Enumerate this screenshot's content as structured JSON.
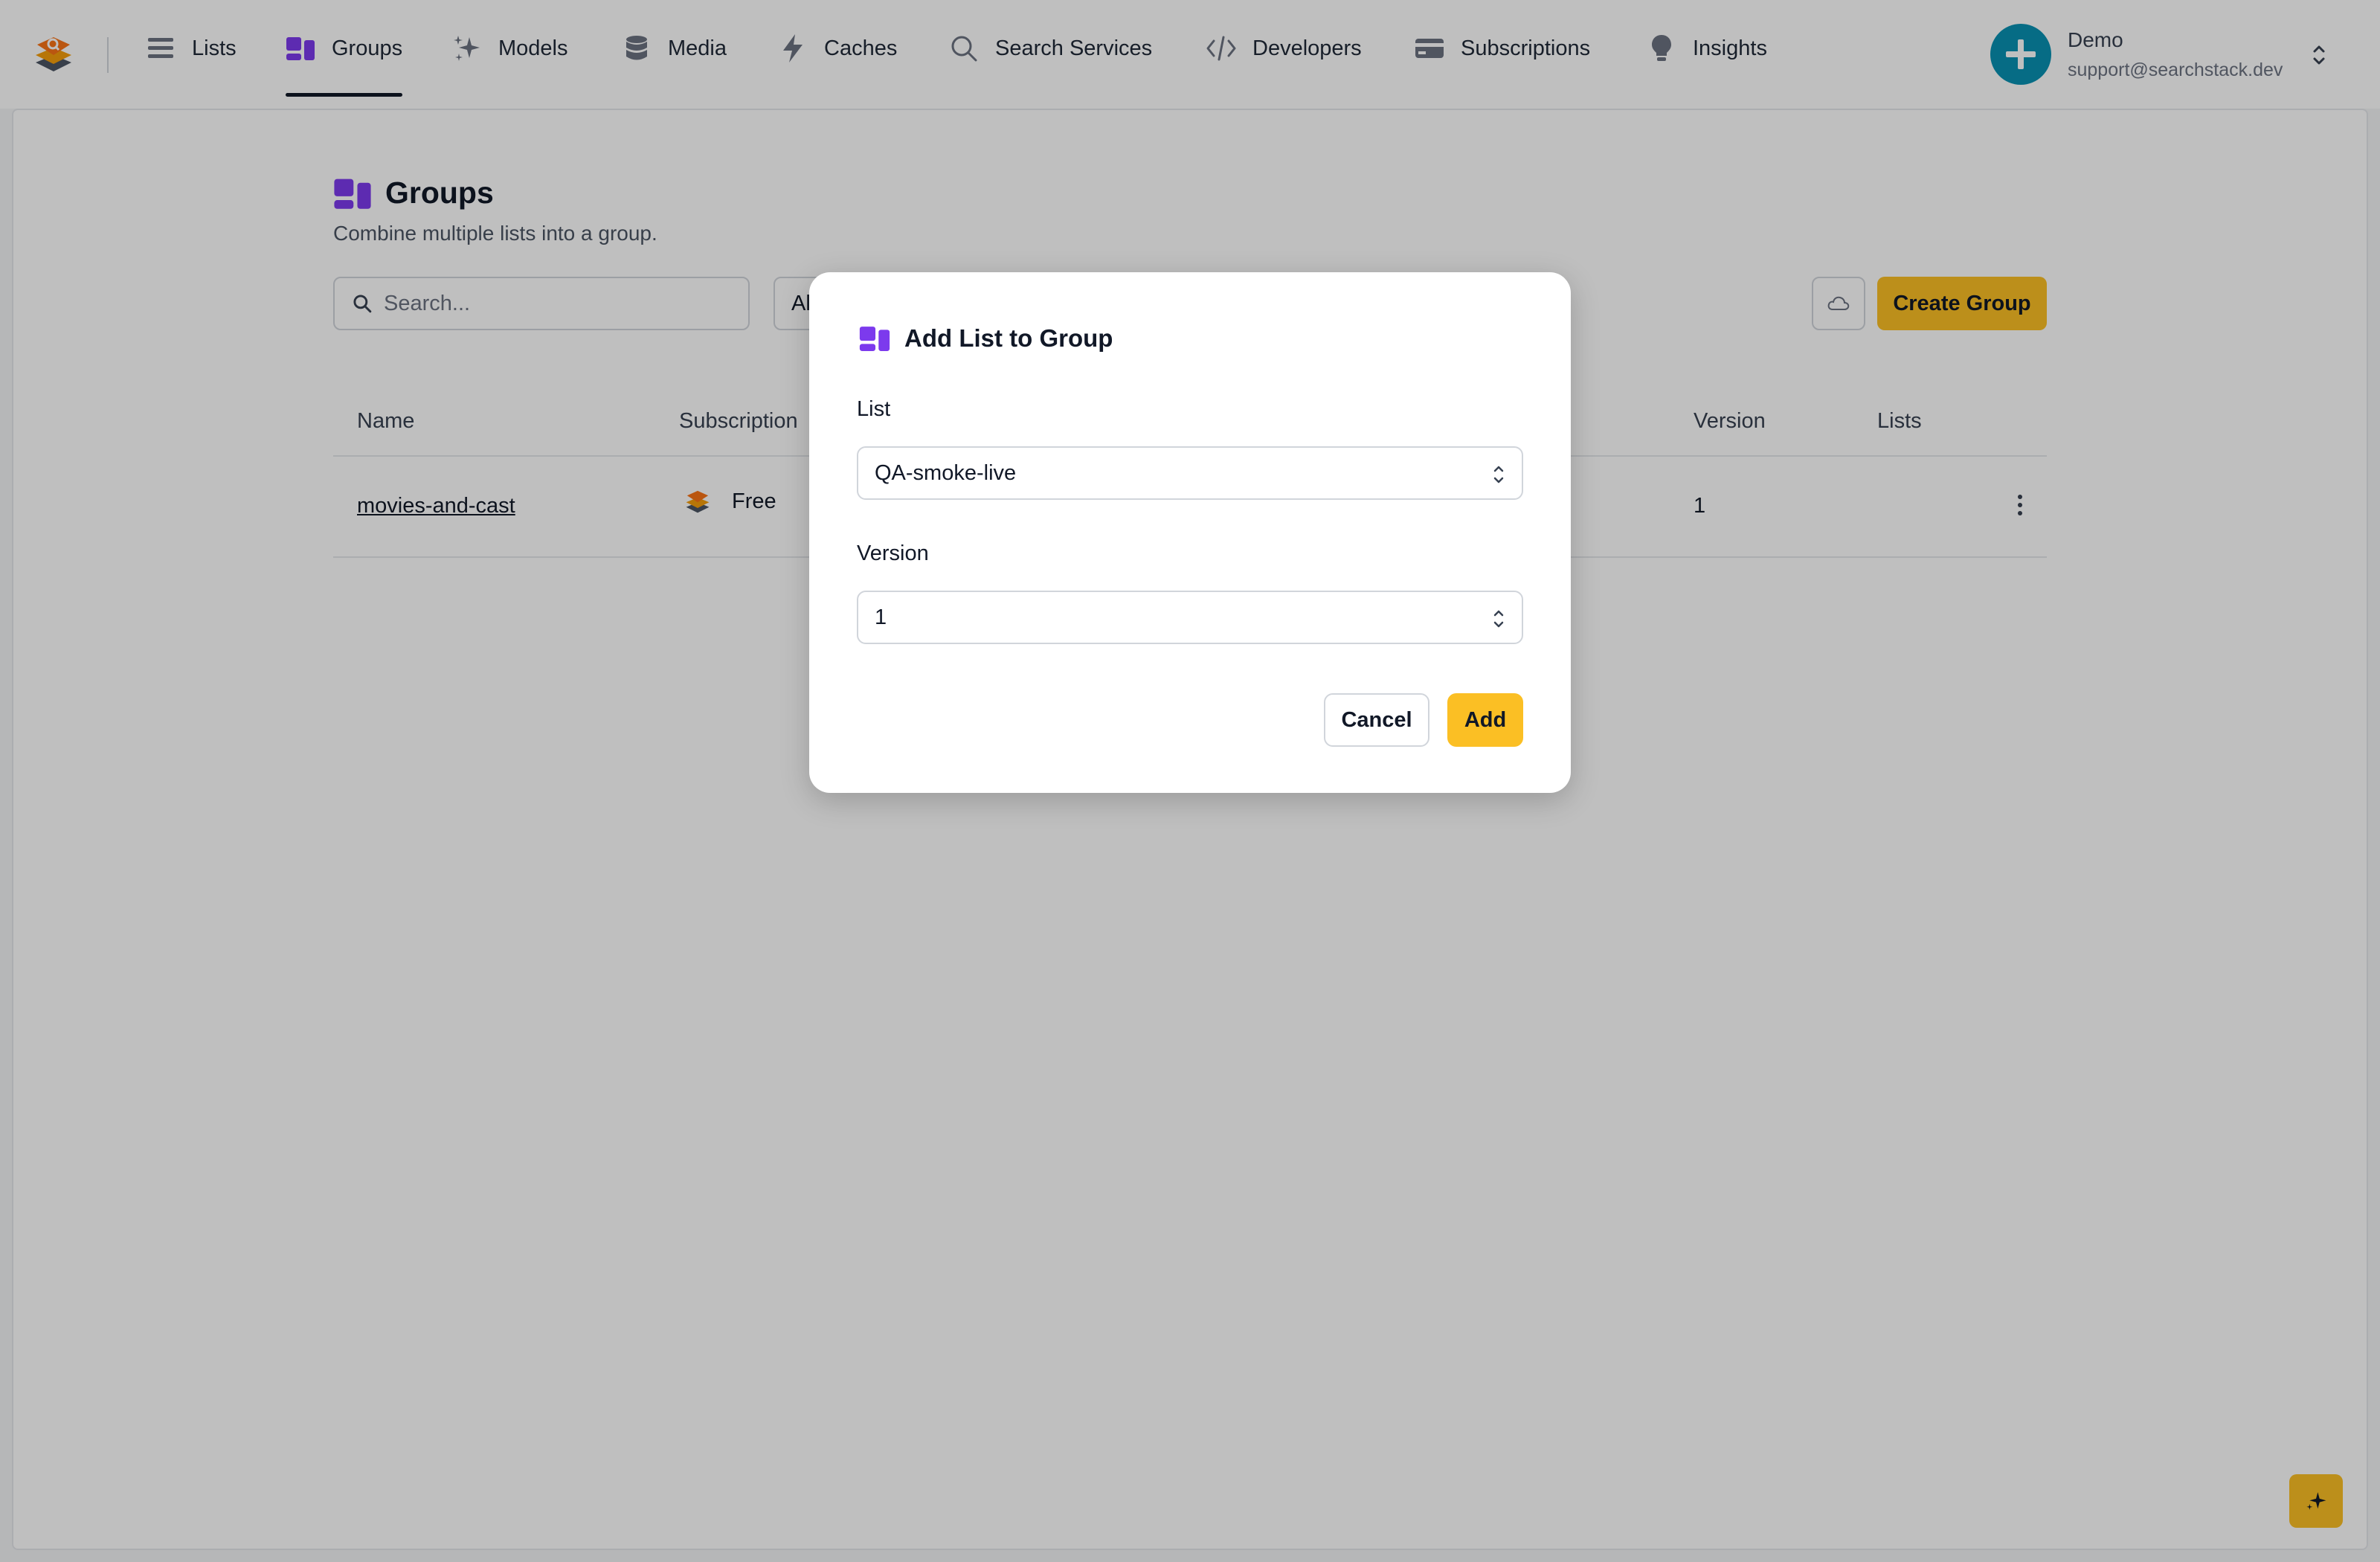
{
  "nav": {
    "items": [
      {
        "label": "Lists",
        "icon": "list-icon"
      },
      {
        "label": "Groups",
        "icon": "groups-icon",
        "active": true
      },
      {
        "label": "Models",
        "icon": "sparkles-icon"
      },
      {
        "label": "Media",
        "icon": "database-icon"
      },
      {
        "label": "Caches",
        "icon": "bolt-icon"
      },
      {
        "label": "Search Services",
        "icon": "search-icon"
      },
      {
        "label": "Developers",
        "icon": "code-icon"
      },
      {
        "label": "Subscriptions",
        "icon": "credit-card-icon"
      },
      {
        "label": "Insights",
        "icon": "lightbulb-icon"
      }
    ]
  },
  "account": {
    "name": "Demo",
    "email": "support@searchstack.dev"
  },
  "page": {
    "title": "Groups",
    "subtitle": "Combine multiple lists into a group.",
    "search_placeholder": "Search...",
    "filter_label": "Al",
    "create_button": "Create Group"
  },
  "table": {
    "columns": [
      "Name",
      "Subscription",
      "Version",
      "Lists"
    ],
    "rows": [
      {
        "name": "movies-and-cast",
        "subscription": "Free",
        "version": "1",
        "lists": ""
      }
    ]
  },
  "modal": {
    "title": "Add List to Group",
    "list_label": "List",
    "list_value": "QA-smoke-live",
    "version_label": "Version",
    "version_value": "1",
    "cancel_label": "Cancel",
    "add_label": "Add"
  },
  "colors": {
    "accent": "#fbbf24",
    "brand_purple": "#7c3aed",
    "avatar": "#0891b2"
  }
}
